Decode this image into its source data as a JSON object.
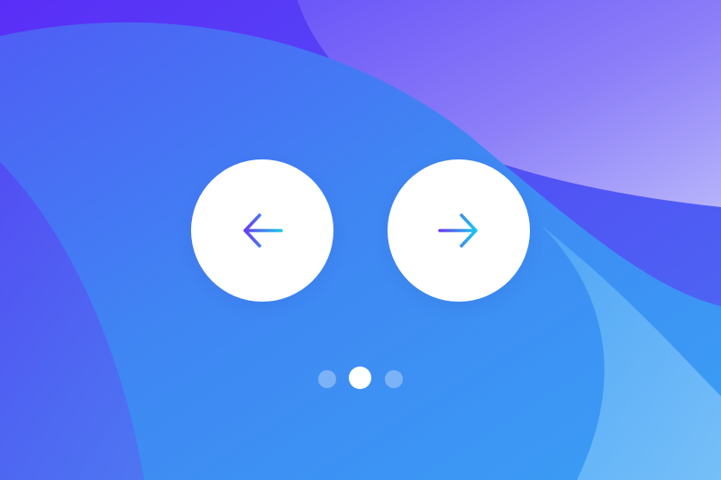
{
  "carousel": {
    "prev_button": {
      "icon": "arrow-left-icon"
    },
    "next_button": {
      "icon": "arrow-right-icon"
    },
    "pagination": {
      "total": 3,
      "active_index": 1
    }
  },
  "colors": {
    "background_purple": "#5a2ef7",
    "background_blue": "#3d8ef4",
    "background_light": "#8ec7fb",
    "arrow_gradient_start": "#6a3cf0",
    "arrow_gradient_end": "#19c8ea",
    "button_fill": "#ffffff",
    "dot_active": "#ffffff",
    "dot_inactive": "rgba(255,255,255,0.32)"
  }
}
